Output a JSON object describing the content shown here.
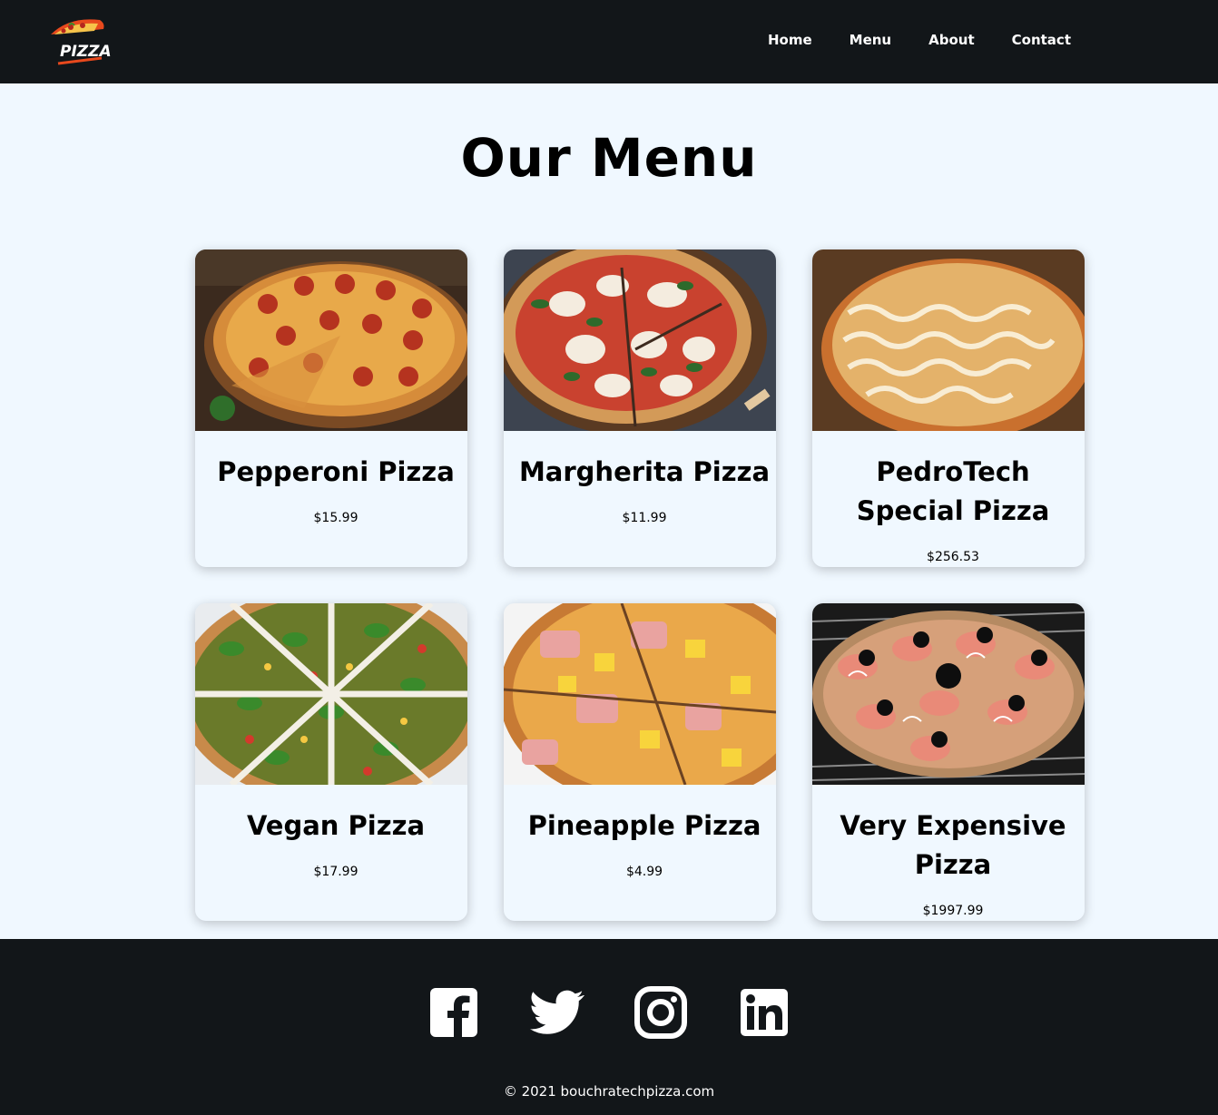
{
  "brand": {
    "logo_text": "PIZZA"
  },
  "nav": {
    "links": [
      {
        "label": "Home"
      },
      {
        "label": "Menu"
      },
      {
        "label": "About"
      },
      {
        "label": "Contact"
      }
    ]
  },
  "menu": {
    "title": "Our Menu",
    "items": [
      {
        "name": "Pepperoni Pizza",
        "price": "$15.99"
      },
      {
        "name": "Margherita Pizza",
        "price": "$11.99"
      },
      {
        "name": "PedroTech Special Pizza",
        "price": "$256.53"
      },
      {
        "name": "Vegan Pizza",
        "price": "$17.99"
      },
      {
        "name": "Pineapple Pizza",
        "price": "$4.99"
      },
      {
        "name": "Very Expensive Pizza",
        "price": "$1997.99"
      }
    ]
  },
  "footer": {
    "socials": [
      {
        "icon": "facebook-icon"
      },
      {
        "icon": "twitter-icon"
      },
      {
        "icon": "instagram-icon"
      },
      {
        "icon": "linkedin-icon"
      }
    ],
    "copyright": "© 2021 bouchratechpizza.com"
  },
  "colors": {
    "dark": "#121619",
    "background": "#f0f8ff",
    "text": "#000000",
    "accent": "#e8491d"
  }
}
